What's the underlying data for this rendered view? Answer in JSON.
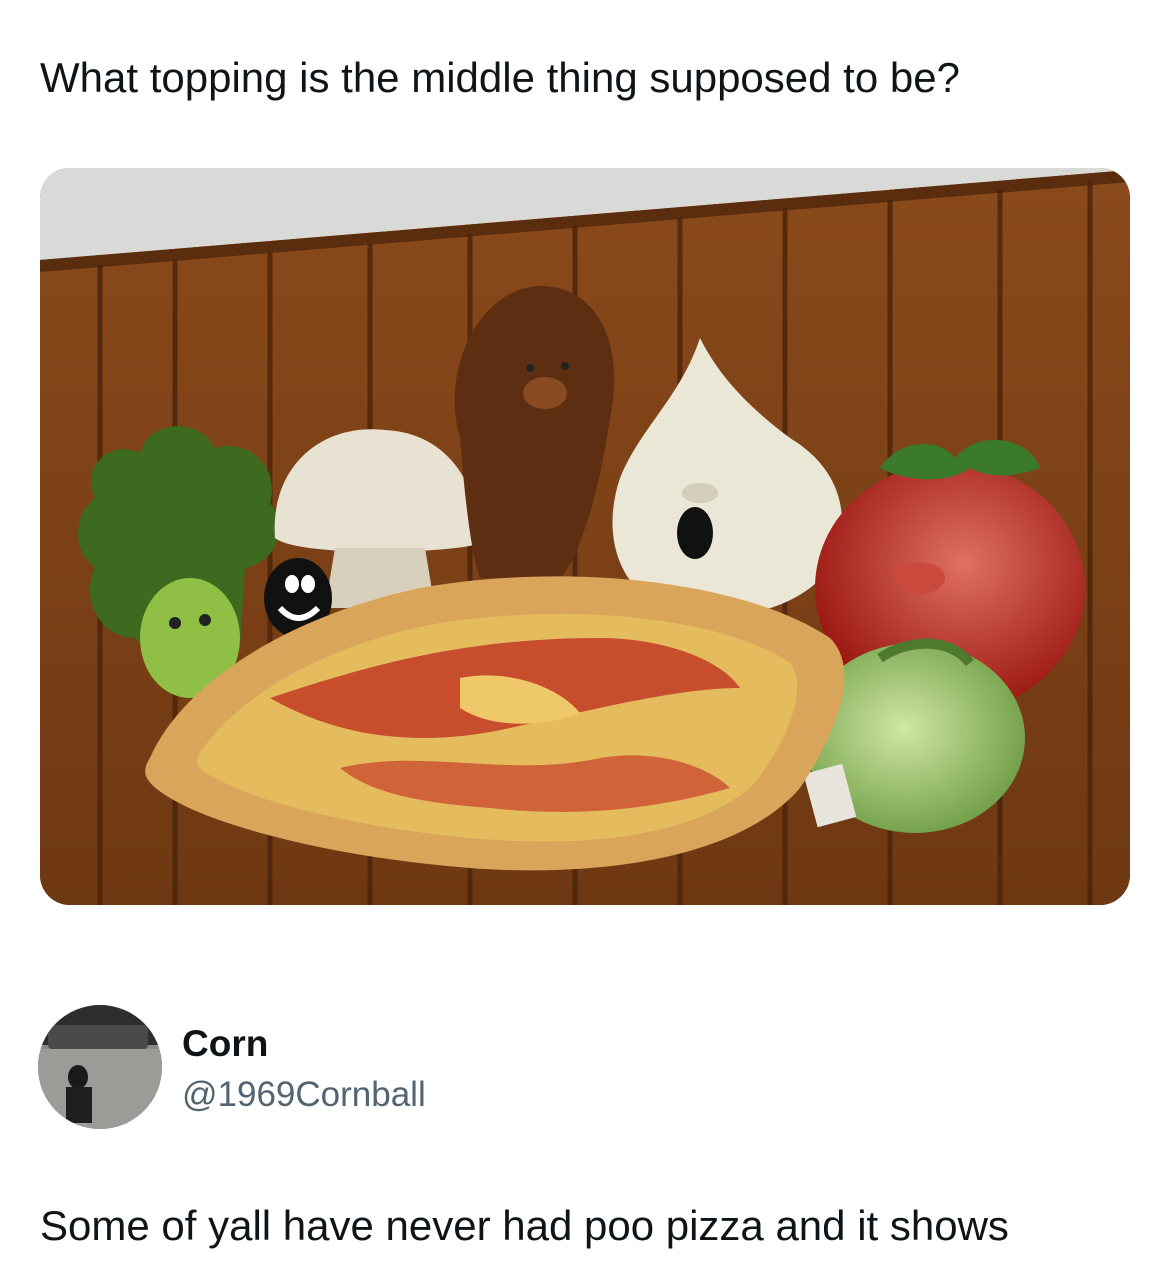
{
  "post": {
    "caption": "What topping is the middle thing supposed to be?",
    "image": {
      "icon": "pizza-vegetable-mural-image"
    }
  },
  "reply": {
    "author": {
      "name": "Corn",
      "handle": "@1969Cornball",
      "avatar_icon": "profile-photo-avatar"
    },
    "text": "Some of yall have never had poo pizza and it shows"
  },
  "colors": {
    "text_primary": "#0f1419",
    "text_secondary": "#536471",
    "background": "#ffffff"
  }
}
